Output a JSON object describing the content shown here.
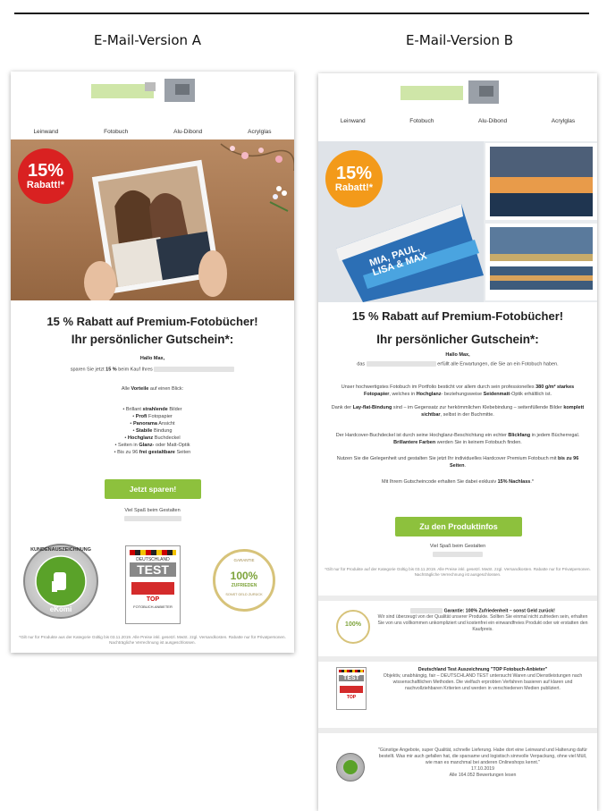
{
  "versions": {
    "a_title": "E-Mail-Version A",
    "b_title": "E-Mail-Version B"
  },
  "nav": [
    "Leinwand",
    "Fotobuch",
    "Alu-Dibond",
    "Acrylglas"
  ],
  "badge": {
    "percent": "15%",
    "label": "Rabatt!*"
  },
  "headline1": "15 % Rabatt auf Premium-Fotobücher!",
  "headline2": "Ihr persönlicher Gutschein*:",
  "greeting": "Hallo Max,",
  "version_a": {
    "intro_prefix": "sparen Sie jetzt",
    "intro_bold": "15 %",
    "intro_suffix": "beim Kauf Ihres",
    "benefits_heading_pre": "Alle",
    "benefits_heading_bold": "Vorteile",
    "benefits_heading_post": "auf einen Blick:",
    "bullets": [
      {
        "pre": "• Brillant",
        "bold": "strahlende",
        "post": "Bilder"
      },
      {
        "pre": "•",
        "bold": "Profi",
        "post": "Fotopapier"
      },
      {
        "pre": "•",
        "bold": "Panorama",
        "post": "Ansicht"
      },
      {
        "pre": "•",
        "bold": "Stabile",
        "post": "Bindung"
      },
      {
        "pre": "•",
        "bold": "Hochglanz",
        "post": "Buchdeckel"
      },
      {
        "pre": "• Seiten in",
        "bold": "Glanz-",
        "post": "oder Matt-Optik"
      },
      {
        "pre": "• Bis zu 96",
        "bold": "frei gestaltbare",
        "post": "Seiten"
      }
    ],
    "cta": "Jetzt sparen!",
    "signoff": "Viel Spaß beim Gestalten",
    "seal_ekomi_text": "KUNDENAUSZEICHNUNG",
    "seal_ekomi_brand": "eKomi",
    "test_top": "DEUTSCHLAND",
    "test_word": "TEST",
    "test_top_label": "TOP",
    "test_sub": "FOTOBUCH-ANBIETER",
    "guarantee_top": "GARANTIE",
    "guarantee_pct": "100%",
    "guarantee_label": "ZUFRIEDEN",
    "guarantee_bottom": "SONST GELD ZURÜCK",
    "footnote": "*Gilt nur für Produkte aus der Kategorie                              Gültig bis 03.11.2019. Alle Preise inkl. gesetzl. MwSt. zzgl. Versandkosten. Rabatte nur für Privatpersonen. Nachträgliche Verrechnung ist ausgeschlossen."
  },
  "version_b": {
    "book_title_1": "MIA, PAUL,",
    "book_title_2": "LISA & MAX",
    "intro_prefix": "das",
    "intro_suffix": "erfüllt alle Erwartungen, die Sie an ein Fotobuch haben.",
    "p1_pre": "Unser hochwertigstes Fotobuch im Portfolio besticht vor allem durch sein professionelles",
    "p1_bold": "380 g/m² starkes Fotopapier",
    "p1_mid": ", welches in",
    "p1_bold2": "Hochglanz",
    "p1_mid2": "- beziehungsweise",
    "p1_bold3": "Seidenmatt",
    "p1_post": "-Optik erhältlich ist.",
    "p2_pre": "Dank der",
    "p2_bold": "Lay-flat-Bindung",
    "p2_mid": "sind – im Gegensatz zur herkömmlichen Klebebindung – seitenfüllende Bilder",
    "p2_bold2": "komplett sichtbar",
    "p2_post": ", selbst in der Buchmitte.",
    "p3_pre": "Der Hardcover-Buchdeckel ist durch seine Hochglanz-Beschichtung ein echter",
    "p3_bold": "Blickfang",
    "p3_mid": "in jedem Bücherregal.",
    "p3_bold2": "Brillantere Farben",
    "p3_post": "werden Sie in keinem Fotobuch finden.",
    "p4_pre": "Nutzen Sie die Gelegenheit und gestalten Sie jetzt Ihr individuelles Hardcover Premium Fotobuch mit",
    "p4_bold": "bis zu 96 Seiten",
    "p4_post": ".",
    "p5_pre": "Mit Ihrem Gutscheincode erhalten Sie dabei exklusiv",
    "p5_bold": "15% Nachlass",
    "p5_post": ".*",
    "cta": "Zu den Produktinfos",
    "signoff": "Viel Spaß beim Gestalten",
    "footnote": "*Gilt nur für Produkte auf der Kategorie                              Gültig bis 03.11.2019. Alle Preise inkl. gesetzl. MwSt. zzgl. Versandkosten. Rabatte nur für Privatpersonen. Nachträgliche Verrechnung ist ausgeschlossen.",
    "guarantee_title": "Garantie: 100% Zufriedenheit – sonst Geld zurück!",
    "guarantee_body": "Wir sind überzeugt von der Qualität unserer Produkte. Sollten Sie einmal nicht zufrieden sein, erhalten Sie von uns vollkommen unkompliziert und kostenfrei ein einwandfreies Produkt oder wir erstatten den Kaufpreis.",
    "test_title": "Deutschland Test Auszeichnung \"TOP Fotobuch-Anbieter\"",
    "test_body": "Objektiv, unabhängig, fair – DEUTSCHLAND TEST untersucht Waren und Dienstleistungen nach wissenschaftlichen Methoden. Die vielfach erprobten Verfahren basieren auf klaren und nachvollziehbaren Kriterien und werden in verschiedenen Medien publiziert.",
    "review_body": "\"Günstige Angebote, super Qualität, schnelle Lieferung. Habe dort eine Leinwand und Halterung dafür bestellt. Was mir auch gefallen hat, die sparsame und logistisch sinnvolle Verpackung, ohne viel Müll, wie man es manchmal bei anderen Onlineshops kennt.\"",
    "review_date": "17.10.2019",
    "review_count": "Alle 164.052 Bewertungen lesen"
  },
  "colors": {
    "badge_a": "#d92121",
    "badge_b": "#f39a1a",
    "cta": "#8dc13d",
    "ekomi_green": "#5aa229",
    "guarantee_gold": "#d7c37a"
  }
}
